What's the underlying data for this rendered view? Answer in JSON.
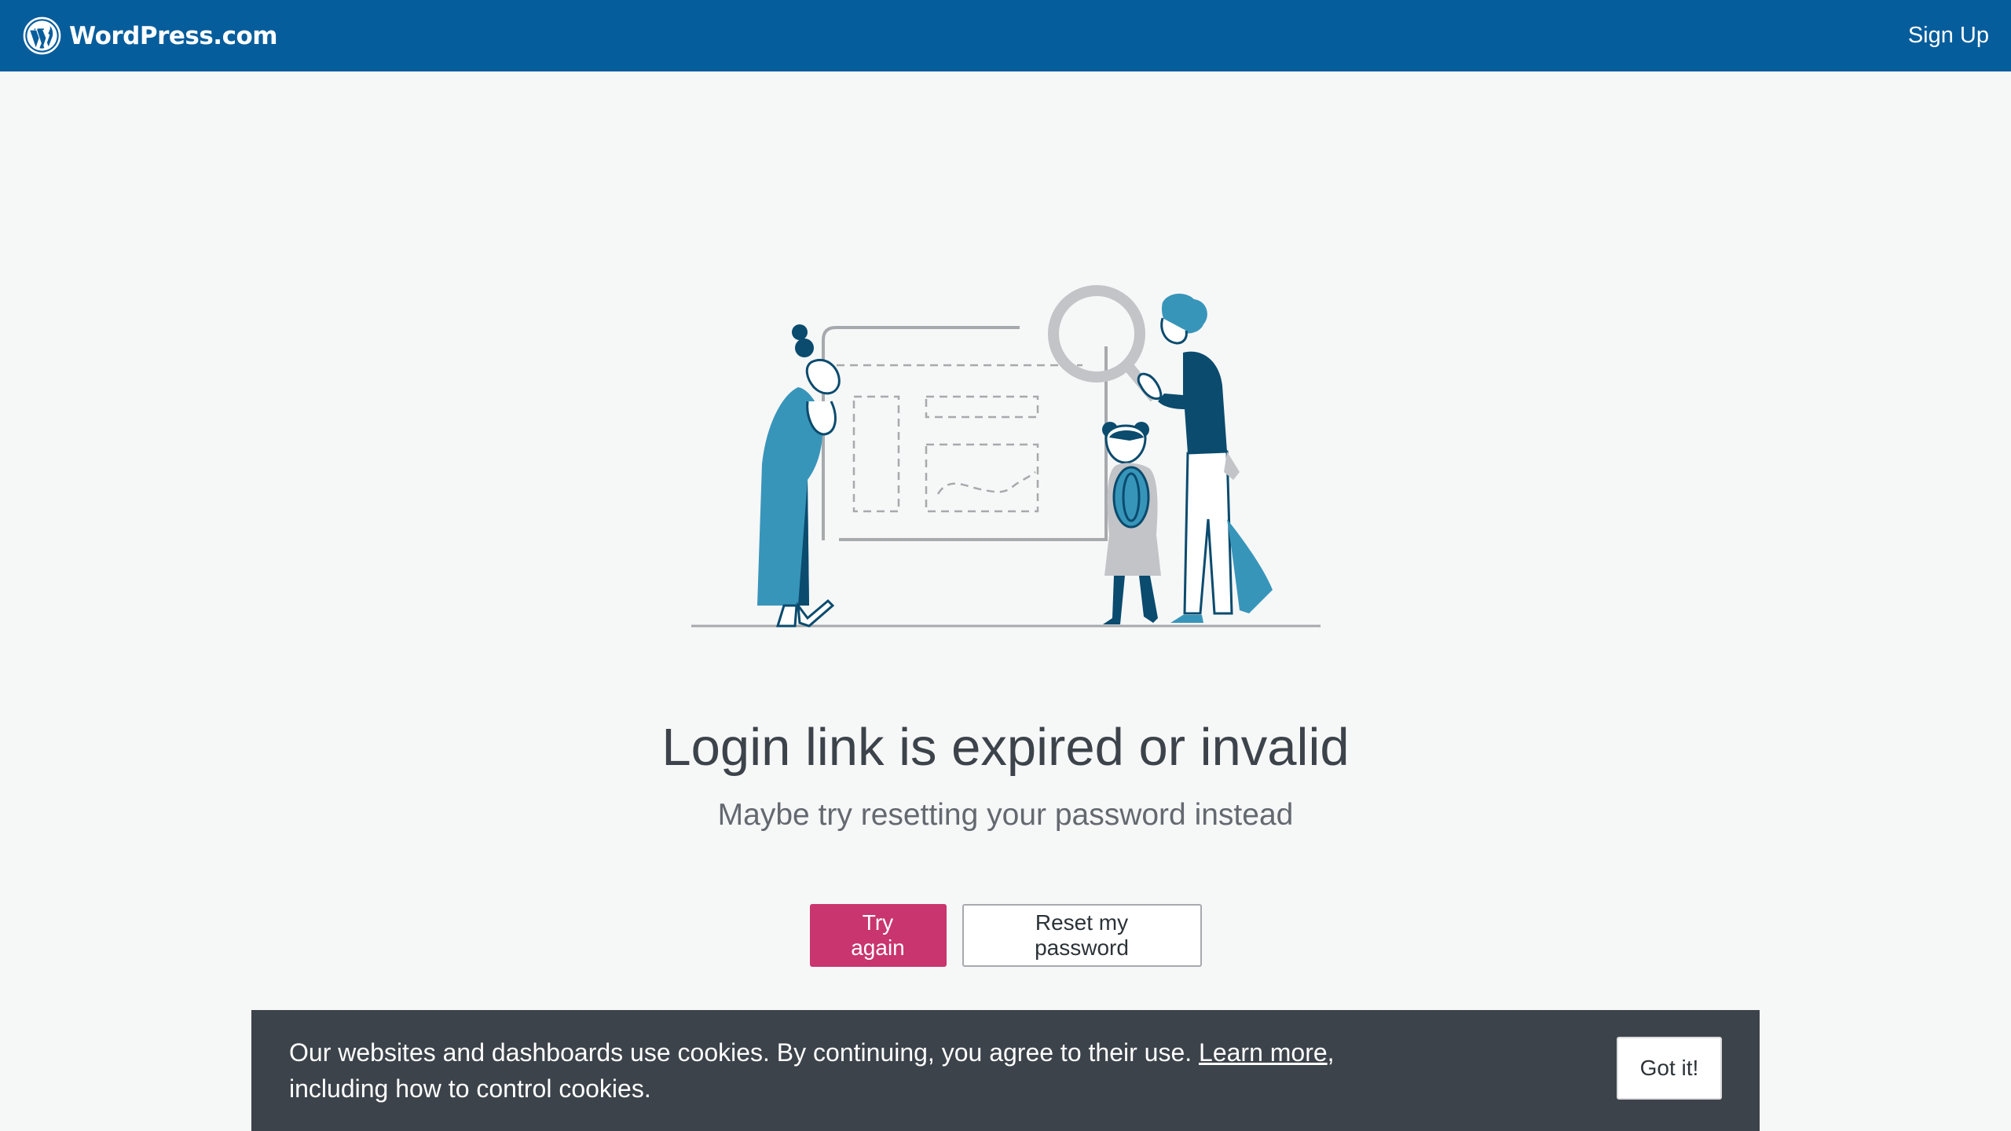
{
  "header": {
    "brand_name": "WordPress.com",
    "signup_label": "Sign Up"
  },
  "main": {
    "title": "Login link is expired or invalid",
    "subtitle": "Maybe try resetting your password instead",
    "try_again_label": "Try again",
    "reset_password_label": "Reset my password"
  },
  "cookie_banner": {
    "text_before": "Our websites and dashboards use cookies. By continuing, you agree to their use. ",
    "link_label": "Learn more",
    "text_after": ", including how to control cookies.",
    "accept_label": "Got it!"
  },
  "colors": {
    "header_bg": "#065d9c",
    "primary_button": "#c9356e",
    "cookie_bg": "#3c434a",
    "illustration_light_blue": "#3895ba",
    "illustration_dark_blue": "#0a4b6e"
  },
  "icons": {
    "brand_logo": "wordpress-logo-icon",
    "illustration": "people-inspecting-webpage-illustration"
  }
}
